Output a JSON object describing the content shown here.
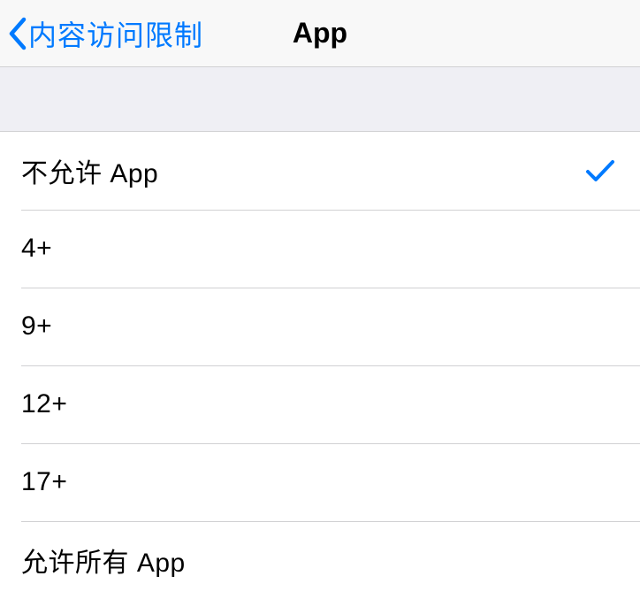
{
  "navbar": {
    "back_label": "内容访问限制",
    "title": "App"
  },
  "options": [
    {
      "label": "不允许 App",
      "selected": true
    },
    {
      "label": "4+",
      "selected": false
    },
    {
      "label": "9+",
      "selected": false
    },
    {
      "label": "12+",
      "selected": false
    },
    {
      "label": "17+",
      "selected": false
    },
    {
      "label": "允许所有 App",
      "selected": false
    }
  ]
}
